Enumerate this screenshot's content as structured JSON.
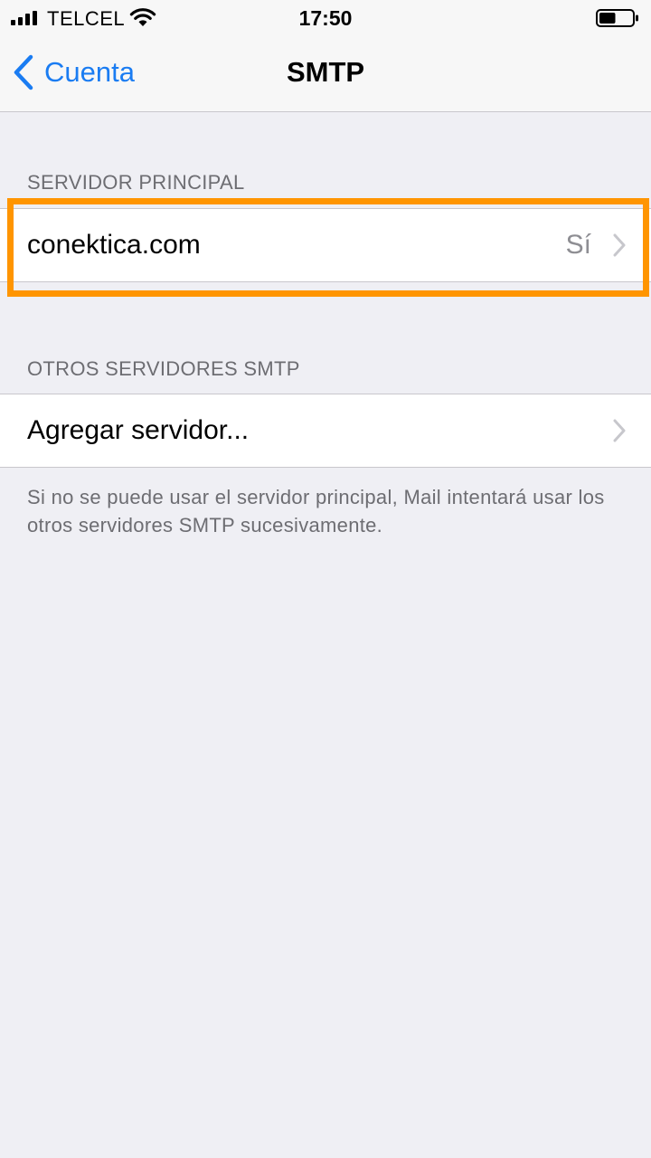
{
  "status_bar": {
    "carrier": "TELCEL",
    "time": "17:50",
    "signal_icon": "cellular-signal-icon",
    "wifi_icon": "wifi-icon",
    "battery_icon": "battery-icon",
    "battery_level": 0.5
  },
  "nav": {
    "back_label": "Cuenta",
    "back_icon": "chevron-left-icon",
    "title": "SMTP"
  },
  "primary_section": {
    "header": "SERVIDOR PRINCIPAL",
    "server": {
      "label": "conektica.com",
      "value": "Sí",
      "chevron_icon": "chevron-right-icon"
    }
  },
  "other_section": {
    "header": "OTROS SERVIDORES SMTP",
    "add_server": {
      "label": "Agregar servidor...",
      "chevron_icon": "chevron-right-icon"
    },
    "footer": "Si no se puede usar el servidor principal, Mail intentará usar los otros servidores SMTP sucesivamente."
  },
  "colors": {
    "background": "#efeff4",
    "accent": "#1a7cf2",
    "highlight": "#ff9500",
    "secondary_text": "#6d6d72"
  }
}
